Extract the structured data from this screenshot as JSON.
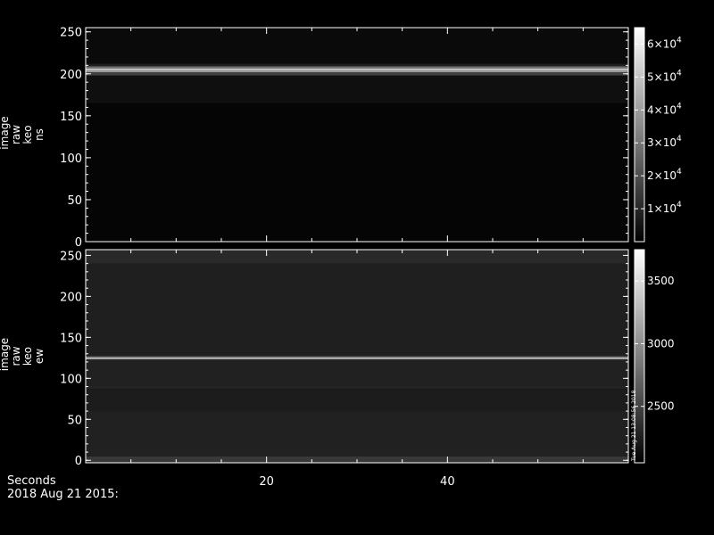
{
  "chart_data": [
    {
      "type": "heatmap",
      "ylabel_lines": [
        "image",
        "raw",
        "keo",
        "ns"
      ],
      "ylim": [
        0,
        255
      ],
      "yticks": [
        0,
        50,
        100,
        150,
        200,
        250
      ],
      "xlim": [
        0,
        60
      ],
      "xticks": [
        20,
        40
      ],
      "show_xtick_labels": false,
      "colorbar": {
        "range": [
          0,
          65000
        ],
        "ticks": [
          10000,
          20000,
          30000,
          40000,
          50000,
          60000
        ],
        "tick_labels": [
          {
            "mantissa": "1×10",
            "exp": "4"
          },
          {
            "mantissa": "2×10",
            "exp": "4"
          },
          {
            "mantissa": "3×10",
            "exp": "4"
          },
          {
            "mantissa": "4×10",
            "exp": "4"
          },
          {
            "mantissa": "5×10",
            "exp": "4"
          },
          {
            "mantissa": "6×10",
            "exp": "4"
          }
        ]
      },
      "bands": [
        {
          "y0": 0,
          "y1": 165,
          "level": 0.02
        },
        {
          "y0": 165,
          "y1": 198,
          "level": 0.06
        },
        {
          "y0": 198,
          "y1": 202,
          "level": 0.25
        },
        {
          "y0": 202,
          "y1": 205,
          "level": 0.65
        },
        {
          "y0": 205,
          "y1": 206,
          "level": 1.0
        },
        {
          "y0": 206,
          "y1": 209,
          "level": 0.45
        },
        {
          "y0": 209,
          "y1": 212,
          "level": 0.12
        },
        {
          "y0": 212,
          "y1": 257,
          "level": 0.04
        }
      ]
    },
    {
      "type": "heatmap",
      "ylabel_lines": [
        "image",
        "raw",
        "keo",
        "ew"
      ],
      "ylim": [
        -3,
        257
      ],
      "yticks": [
        0,
        50,
        100,
        150,
        200,
        250
      ],
      "xlim": [
        0,
        60
      ],
      "xticks": [
        20,
        40
      ],
      "show_xtick_labels": true,
      "xlabel": "Seconds",
      "colorbar": {
        "range": [
          2050,
          3750
        ],
        "ticks": [
          2500,
          3000,
          3500
        ],
        "tick_labels": [
          {
            "mantissa": "2500",
            "exp": ""
          },
          {
            "mantissa": "3000",
            "exp": ""
          },
          {
            "mantissa": "3500",
            "exp": ""
          }
        ]
      },
      "bands": [
        {
          "y0": -3,
          "y1": 5,
          "level": 0.22
        },
        {
          "y0": 5,
          "y1": 60,
          "level": 0.13
        },
        {
          "y0": 60,
          "y1": 88,
          "level": 0.11
        },
        {
          "y0": 88,
          "y1": 89,
          "level": 0.2
        },
        {
          "y0": 89,
          "y1": 123,
          "level": 0.13
        },
        {
          "y0": 123,
          "y1": 124.5,
          "level": 0.55
        },
        {
          "y0": 124.5,
          "y1": 125.5,
          "level": 0.95
        },
        {
          "y0": 125.5,
          "y1": 127,
          "level": 0.4
        },
        {
          "y0": 127,
          "y1": 240,
          "level": 0.12
        },
        {
          "y0": 240,
          "y1": 257,
          "level": 0.16
        }
      ]
    }
  ],
  "footer": {
    "x_axis_label": "Seconds",
    "date": "2018 Aug 21 2015:"
  },
  "stamp": "Tue Aug 21 13:08:56 2018"
}
